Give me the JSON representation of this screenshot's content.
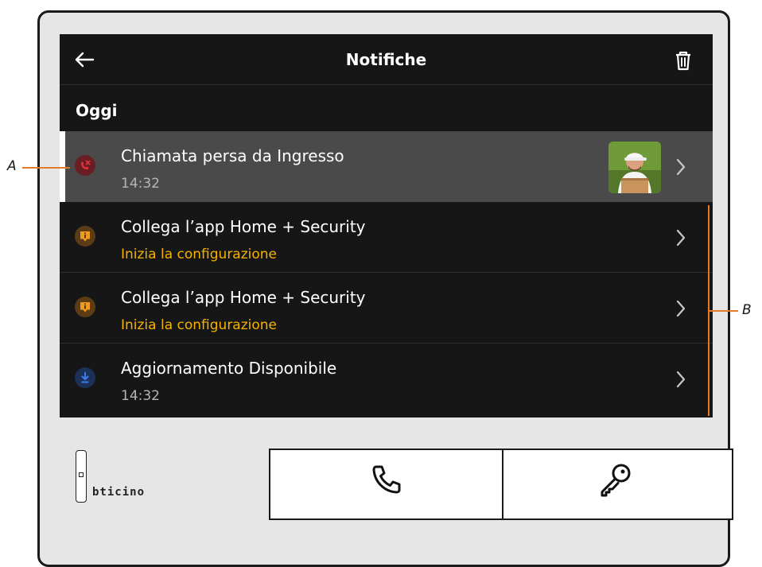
{
  "header": {
    "title": "Notifiche"
  },
  "section": {
    "label": "Oggi"
  },
  "notifications": [
    {
      "title": "Chiamata persa da Ingresso",
      "subtitle": "14:32",
      "icon": "missed-call-icon"
    },
    {
      "title": "Collega l’app Home + Security",
      "subtitle": "Inizia la configurazione",
      "icon": "info-alert-icon"
    },
    {
      "title": "Collega l’app Home + Security",
      "subtitle": "Inizia la configurazione",
      "icon": "info-alert-icon"
    },
    {
      "title": "Aggiornamento Disponibile",
      "subtitle": "14:32",
      "icon": "download-icon"
    }
  ],
  "callouts": {
    "a": "A",
    "b": "B"
  },
  "brand": "bticino",
  "colors": {
    "screen_bg": "#161616",
    "selected_row": "#4a4a4a",
    "accent": "#f5b300",
    "missed_call": "#e2333c",
    "info_icon": "#e08a18",
    "download_icon": "#2c6be0",
    "callout": "#e37a2a"
  }
}
